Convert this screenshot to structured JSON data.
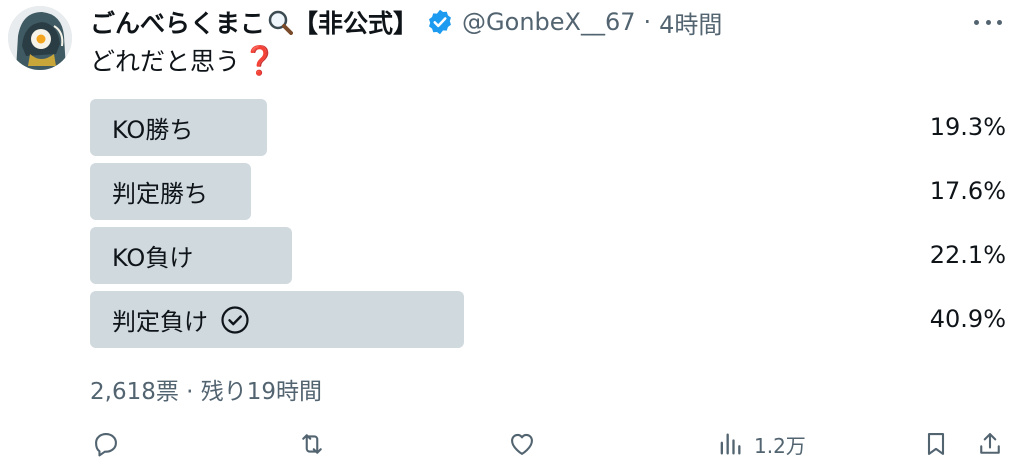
{
  "author": {
    "display_name": "ごんべらくまこ",
    "display_suffix": "【非公式】",
    "handle": "@GonbeX__67",
    "separator": "·",
    "time": "4時間"
  },
  "tweet": {
    "text": "どれだと思う",
    "emoji": "❓"
  },
  "poll": {
    "options": [
      {
        "label": "KO勝ち",
        "percent": "19.3%",
        "fraction": 0.193
      },
      {
        "label": "判定勝ち",
        "percent": "17.6%",
        "fraction": 0.176
      },
      {
        "label": "KO負け",
        "percent": "22.1%",
        "fraction": 0.221
      },
      {
        "label": "判定負け",
        "percent": "40.9%",
        "fraction": 0.409,
        "winner": true
      }
    ],
    "meta": "2,618票 · 残り19時間"
  },
  "actions": {
    "views": "1.2万"
  },
  "colors": {
    "bar": "#cfd9de",
    "verified": "#1d9bf0",
    "secondary_text": "#536471"
  },
  "icons": [
    "more-icon",
    "verified-icon",
    "magnifier-icon",
    "check-circle-icon",
    "reply-icon",
    "retweet-icon",
    "like-icon",
    "views-icon",
    "bookmark-icon",
    "share-icon"
  ]
}
